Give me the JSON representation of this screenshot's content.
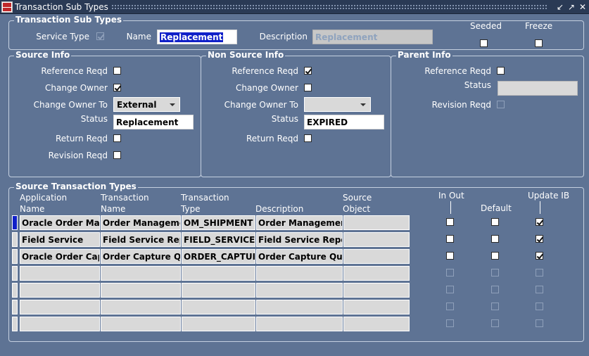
{
  "window": {
    "title": "Transaction Sub Types",
    "controls": [
      "↙",
      "↗",
      "✕"
    ]
  },
  "header": {
    "section_label": "Transaction Sub Types",
    "service_type_label": "Service Type",
    "service_type_checked": true,
    "name_label": "Name",
    "name_value": "Replacement",
    "description_label": "Description",
    "description_value": "Replacement",
    "seeded_label": "Seeded",
    "freeze_label": "Freeze"
  },
  "source_info": {
    "title": "Source Info",
    "reference_reqd_label": "Reference Reqd",
    "change_owner_label": "Change Owner",
    "change_owner_to_label": "Change Owner To",
    "change_owner_to_value": "External",
    "status_label": "Status",
    "status_value": "Replacement",
    "return_reqd_label": "Return Reqd",
    "revision_reqd_label": "Revision Reqd"
  },
  "non_source_info": {
    "title": "Non Source Info",
    "reference_reqd_label": "Reference Reqd",
    "change_owner_label": "Change Owner",
    "change_owner_to_label": "Change Owner To",
    "change_owner_to_value": "",
    "status_label": "Status",
    "status_value": "EXPIRED",
    "return_reqd_label": "Return Reqd"
  },
  "parent_info": {
    "title": "Parent Info",
    "reference_reqd_label": "Reference Reqd",
    "status_label": "Status",
    "revision_reqd_label": "Revision Reqd"
  },
  "source_txn": {
    "title": "Source Transaction Types",
    "col_app_1": "Application",
    "col_app_2": "Name",
    "col_txn_1": "Transaction",
    "col_txn_2": "Name",
    "col_type_1": "Transaction",
    "col_type_2": "Type",
    "col_desc": "Description",
    "col_src_1": "Source",
    "col_src_2": "Object",
    "col_inout": "In Out",
    "col_default": "Default",
    "col_update": "Update IB",
    "rows": [
      {
        "app": "Oracle Order Mar",
        "txn": "Order Manageme",
        "type": "OM_SHIPMENT",
        "desc": "Order Managemen",
        "src": ""
      },
      {
        "app": "Field Service",
        "txn": "Field Service Rep",
        "type": "FIELD_SERVICE_",
        "desc": "Field Service Repo",
        "src": ""
      },
      {
        "app": "Oracle Order Cap",
        "txn": "Order Capture Qu",
        "type": "ORDER_CAPTUF",
        "desc": "Order Capture Quo",
        "src": ""
      },
      {
        "app": "",
        "txn": "",
        "type": "",
        "desc": "",
        "src": ""
      },
      {
        "app": "",
        "txn": "",
        "type": "",
        "desc": "",
        "src": ""
      },
      {
        "app": "",
        "txn": "",
        "type": "",
        "desc": "",
        "src": ""
      },
      {
        "app": "",
        "txn": "",
        "type": "",
        "desc": "",
        "src": ""
      }
    ]
  }
}
